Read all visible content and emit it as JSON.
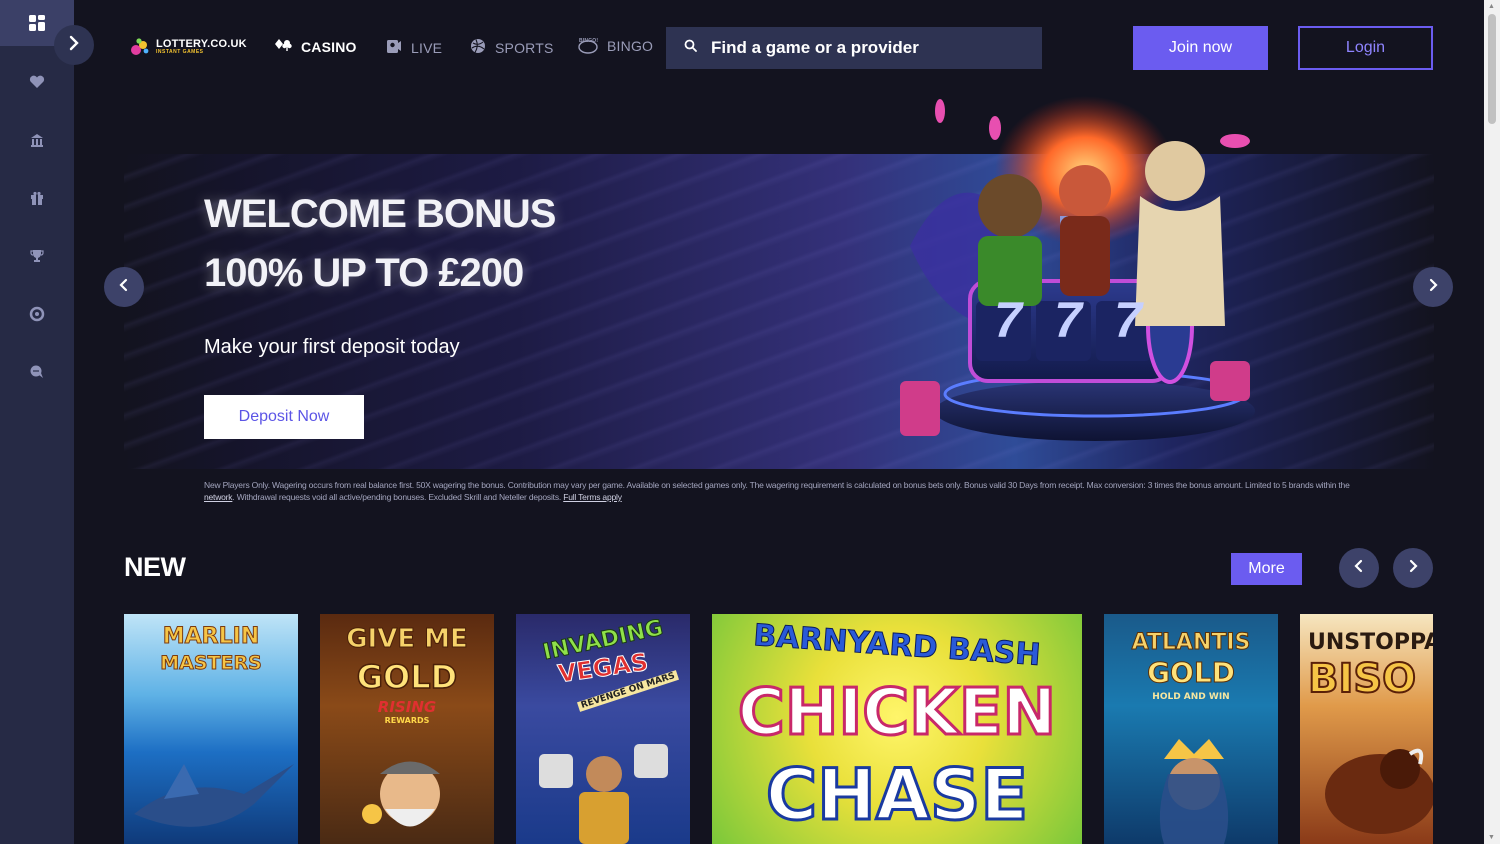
{
  "brand": {
    "name": "LOTTERY.CO.UK",
    "tagline": "INSTANT GAMES"
  },
  "sidebar": {
    "items": [
      {
        "name": "home-grid",
        "icon": "grid-icon"
      },
      {
        "name": "favourites",
        "icon": "heart-icon"
      },
      {
        "name": "casino",
        "icon": "casino-icon"
      },
      {
        "name": "promotions",
        "icon": "gift-icon"
      },
      {
        "name": "tournaments",
        "icon": "trophy-icon"
      },
      {
        "name": "responsible-gaming",
        "icon": "lifebuoy-icon"
      },
      {
        "name": "support",
        "icon": "chat-icon"
      }
    ]
  },
  "nav": {
    "casino": "CASINO",
    "live": "LIVE",
    "sports": "SPORTS",
    "bingo": "BINGO",
    "bingo_badge": "BINGO!"
  },
  "search": {
    "placeholder": "Find a game or a provider"
  },
  "header": {
    "join_label": "Join now",
    "login_label": "Login"
  },
  "banner": {
    "title_line1": "WELCOME BONUS",
    "title_line2": "100% UP TO £200",
    "subtitle": "Make your first deposit today",
    "cta_label": "Deposit Now",
    "slot_reels": [
      "7",
      "7",
      "7"
    ]
  },
  "terms": {
    "text_1": "New Players Only. Wagering occurs from real balance first. 50X wagering the bonus. Contribution may vary per game. Available on selected games only. The wagering requirement is calculated on bonus bets only. Bonus valid 30 Days from receipt. Max conversion: 3 times the bonus amount. Limited to 5 brands within the",
    "link_network": "network",
    "text_2": ". Withdrawal requests void all active/pending bonuses. Excluded Skrill and Neteller deposits.",
    "link_terms": "Full Terms apply"
  },
  "new_section": {
    "title": "NEW",
    "more_label": "More",
    "games": [
      {
        "line1": "MARLIN",
        "line2": "MASTERS",
        "line3": "",
        "line4": ""
      },
      {
        "line1": "GIVE ME",
        "line2": "GOLD",
        "line3": "RISING",
        "line4": "REWARDS"
      },
      {
        "line1": "INVADING",
        "line2": "VEGAS",
        "line3": "REVENGE ON MARS",
        "line4": ""
      },
      {
        "line1": "BARNYARD BASH",
        "line2": "CHICKEN",
        "line3": "CHASE",
        "line4": ""
      },
      {
        "line1": "ATLANTIS",
        "line2": "GOLD",
        "line3": "HOLD AND WIN",
        "line4": ""
      },
      {
        "line1": "UNSTOPPAI",
        "line2": "BISO",
        "line3": "",
        "line4": ""
      }
    ]
  },
  "colors": {
    "accent": "#6b5cf0",
    "sidebar": "#262a45",
    "page_bg": "#13131f",
    "search_bg": "#2e3352"
  }
}
